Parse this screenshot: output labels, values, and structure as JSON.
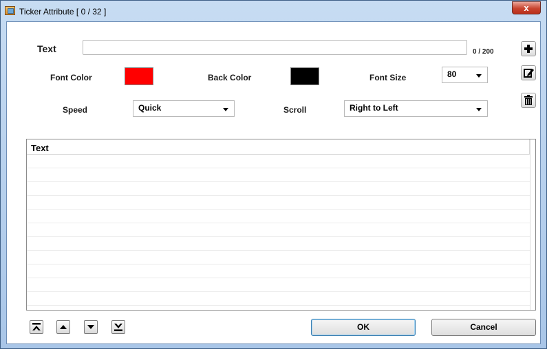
{
  "window": {
    "title": "Ticker Attribute [ 0 / 32 ]",
    "close_glyph": "x"
  },
  "form": {
    "text_label": "Text",
    "text_value": "",
    "counter": "0 / 200",
    "font_color_label": "Font Color",
    "font_color": "#ff0000",
    "back_color_label": "Back Color",
    "back_color": "#000000",
    "font_size_label": "Font Size",
    "font_size_value": "80",
    "speed_label": "Speed",
    "speed_value": "Quick",
    "scroll_label": "Scroll",
    "scroll_value": "Right to Left"
  },
  "side_buttons": {
    "icons": [
      "plus-icon",
      "edit-icon",
      "trash-icon"
    ]
  },
  "grid": {
    "header": "Text",
    "rows": []
  },
  "nav_icons": [
    "move-top-icon",
    "move-up-icon",
    "move-down-icon",
    "move-bottom-icon"
  ],
  "buttons": {
    "ok": "OK",
    "cancel": "Cancel"
  }
}
